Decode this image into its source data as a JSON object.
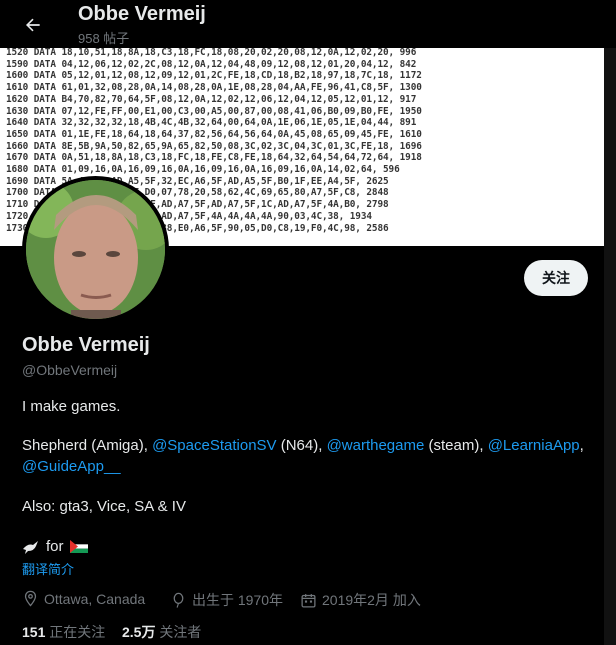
{
  "header": {
    "title": "Obbe Vermeij",
    "post_count": "958 帖子"
  },
  "banner": {
    "lines": [
      "1520 DATA 18,10,51,18,8A,18,C3,18,FC,18,08,20,02,20,08,12,0A,12,02,20, 996",
      "1590 DATA 04,12,06,12,02,2C,08,12,0A,12,04,48,09,12,08,12,01,20,04,12, 842",
      "1600 DATA 05,12,01,12,08,12,09,12,01,2C,FE,18,CD,18,B2,18,97,18,7C,18, 1172",
      "1610 DATA 61,01,32,08,28,0A,14,08,28,0A,1E,08,28,04,AA,FE,96,41,C8,5F, 1300",
      "1620 DATA B4,70,82,70,64,5F,08,12,0A,12,02,12,06,12,04,12,05,12,01,12, 917",
      "1630 DATA 07,12,FE,FF,00,E1,00,C3,00,A5,00,87,00,08,41,06,B0,09,B0,FE, 1950",
      "1640 DATA 32,32,32,32,18,4B,4C,4B,32,64,00,64,0A,1E,06,1E,05,1E,04,44, 891",
      "1650 DATA 01,1E,FE,18,64,18,64,37,82,56,64,56,64,0A,45,08,65,09,45,FE, 1610",
      "1660 DATA 8E,5B,9A,50,82,65,9A,65,82,50,08,3C,02,3C,04,3C,01,3C,FE,18, 1696",
      "1670 DATA 0A,51,18,8A,18,C3,18,FC,18,FE,C8,FE,18,64,32,64,54,64,72,64, 1918",
      "1680 DATA 01,09,16,0A,16,09,16,0A,16,09,16,0A,16,09,16,0A,14,02,64, 596",
      "1690 DATA 5A,41,FE,AD,A5,5F,32,EC,A6,5F,AD,A5,5F,B0,1F,EE,A4,5F, 2625",
      "1700 DATA 9A,61,FB,C9,FE,D0,07,78,20,58,62,4C,69,65,80,A7,5F,C8, 2848",
      "1710 DATA 2A,61,FB,2D,A5,5F,AD,A7,5F,AD,A7,5F,1C,AD,A7,5F,4A,B0, 2798",
      "1720 DATA 4A,4A,4A,4A,B0,33,AD,A7,5F,4A,4A,4A,4A,90,03,4C,38, 1934",
      "1730 DATA 4A,4A,4A,B0,05,D0,38,E0,A6,5F,90,05,D0,C8,19,F0,4C,98, 2586"
    ]
  },
  "profile": {
    "follow_label": "关注",
    "name": "Obbe Vermeij",
    "handle": "@ObbeVermeij",
    "bio_line1": "I make games.",
    "bio_line2_a": "Shepherd (Amiga), ",
    "bio_link1": "@SpaceStationSV",
    "bio_line2_b": " (N64), ",
    "bio_link2": "@warthegame",
    "bio_line2_c": " (steam), ",
    "bio_link3": "@LearniaApp",
    "bio_line2_d": ",",
    "bio_link4": "@GuideApp__",
    "bio_line3": "Also: gta3, Vice, SA & IV",
    "bio_line4": "for",
    "translate_label": "翻译简介",
    "location": "Ottawa, Canada",
    "birth": "出生于 1970年",
    "joined": "2019年2月 加入",
    "following_count": "151",
    "following_label": "正在关注",
    "followers_count": "2.5万",
    "followers_label": "关注者"
  }
}
